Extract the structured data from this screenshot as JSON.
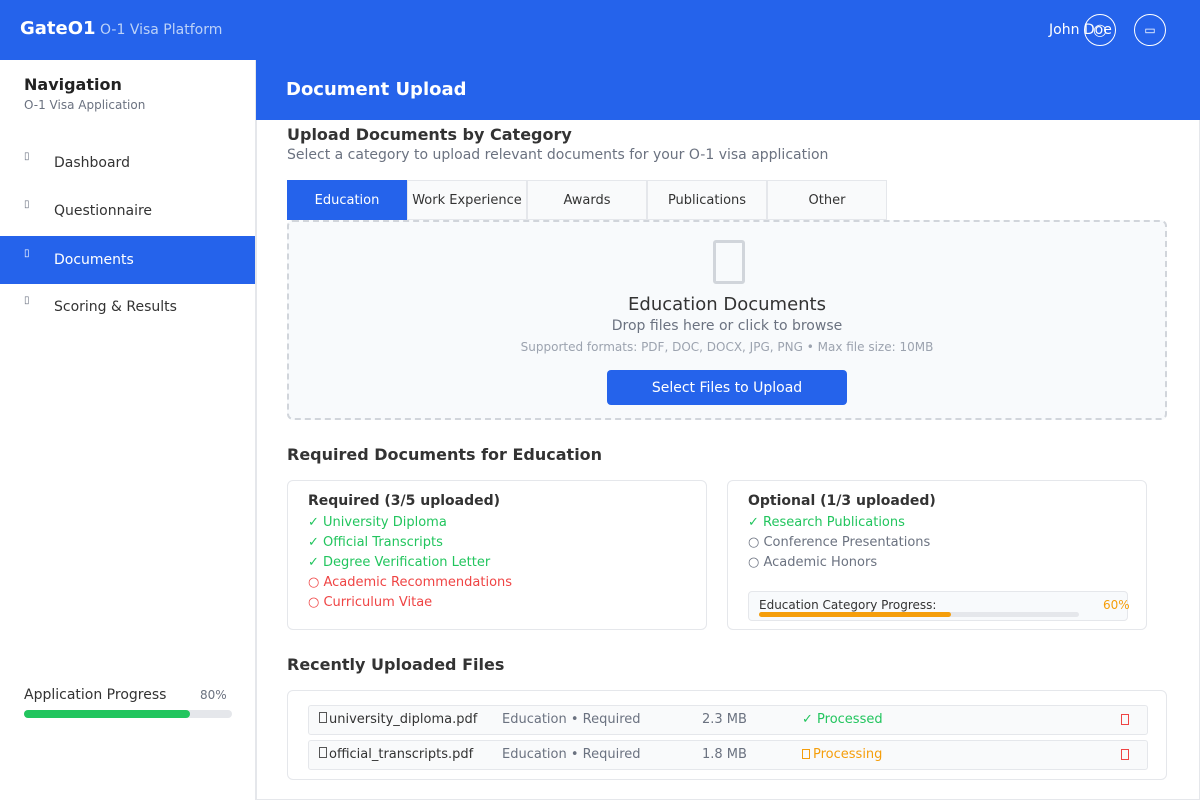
{
  "header": {
    "logo": "GateO1",
    "subtitle": "O-1 Visa Platform",
    "user": "John Doe",
    "icons": [
      "user-icon",
      "logout-icon"
    ]
  },
  "sidebar": {
    "title": "Navigation",
    "subtitle": "O-1 Visa Application",
    "items": [
      {
        "label": "Dashboard",
        "icon": "dashboard-icon",
        "active": false
      },
      {
        "label": "Questionnaire",
        "icon": "questionnaire-icon",
        "active": false
      },
      {
        "label": "Documents",
        "icon": "documents-icon",
        "active": true
      },
      {
        "label": "Scoring & Results",
        "icon": "scoring-icon",
        "active": false
      }
    ],
    "progress": {
      "label": "Application Progress",
      "value": "80%",
      "fraction": 0.8
    }
  },
  "main": {
    "title": "Document Upload",
    "section_title": "Upload Documents by Category",
    "section_subtitle": "Select a category to upload relevant documents for your O-1 visa application",
    "tabs": [
      "Education",
      "Work Experience",
      "Awards",
      "Publications",
      "Other"
    ],
    "active_tab": "Education",
    "dropzone": {
      "title": "Education Documents",
      "subtitle": "Drop files here or click to browse",
      "formats": "Supported formats: PDF, DOC, DOCX, JPG, PNG • Max file size: 10MB",
      "button": "Select Files to Upload"
    },
    "required_heading": "Required Documents for Education",
    "required": {
      "title": "Required (3/5 uploaded)",
      "items": [
        {
          "text": "✓ University Diploma",
          "status": "ok"
        },
        {
          "text": "✓ Official Transcripts",
          "status": "ok"
        },
        {
          "text": "✓ Degree Verification Letter",
          "status": "ok"
        },
        {
          "text": "○ Academic Recommendations",
          "status": "missing"
        },
        {
          "text": "○ Curriculum Vitae",
          "status": "missing"
        }
      ]
    },
    "optional": {
      "title": "Optional (1/3 uploaded)",
      "items": [
        {
          "text": "✓ Research Publications",
          "status": "ok"
        },
        {
          "text": "○ Conference Presentations",
          "status": "none"
        },
        {
          "text": "○ Academic Honors",
          "status": "none"
        }
      ],
      "progress_label": "Education Category Progress:",
      "progress_value": "60%",
      "progress_fraction": 0.6
    },
    "recent_heading": "Recently Uploaded Files",
    "files": [
      {
        "name": "university_diploma.pdf",
        "category": "Education • Required",
        "size": "2.3 MB",
        "status": "✓ Processed",
        "state": "processed"
      },
      {
        "name": "official_transcripts.pdf",
        "category": "Education • Required",
        "size": "1.8 MB",
        "status": "Processing",
        "state": "processing"
      }
    ]
  },
  "colors": {
    "primary": "#2563eb",
    "success": "#22c55e",
    "warning": "#f59e0b",
    "danger": "#ef4444"
  }
}
